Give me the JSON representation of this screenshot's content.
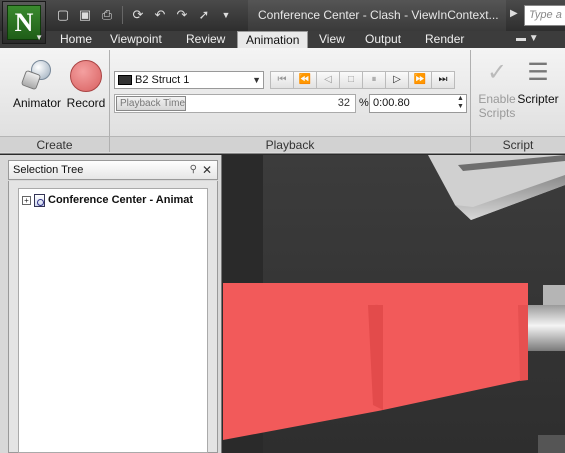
{
  "window": {
    "title": "Conference Center - Clash - ViewInContext...",
    "search_placeholder": "Type a keyword or phrase",
    "app_logo_letter": "N"
  },
  "quick_access": [
    "new-icon",
    "save-icon",
    "print-icon",
    "refresh-icon",
    "undo-icon",
    "redo-icon",
    "select-icon",
    "customize-icon"
  ],
  "tabs": [
    "Home",
    "Viewpoint",
    "Review",
    "Animation",
    "View",
    "Output",
    "Render"
  ],
  "active_tab": "Animation",
  "ribbon": {
    "create": {
      "title": "Create",
      "animator_label": "Animator",
      "record_label": "Record"
    },
    "playback": {
      "title": "Playback",
      "animation_select": "B2 Struct 1",
      "slider_label": "Playback Time",
      "percent_value": "32",
      "percent_symbol": "%",
      "time_value": "0:00.80",
      "progress_percent": 32,
      "transport": {
        "rewind": "⏮",
        "step_back": "⏪",
        "play_reverse": "◁",
        "stop": "□",
        "pause": "⏸",
        "play": "▷",
        "step_forward": "⏩",
        "end": "⏭"
      }
    },
    "script": {
      "title": "Script",
      "enable_scripts_line1": "Enable",
      "enable_scripts_line2": "Scripts",
      "scripter_label": "Scripter"
    }
  },
  "selection_tree": {
    "title": "Selection Tree",
    "root_item": "Conference Center - Animat",
    "expander": "+"
  },
  "colors": {
    "accent_red": "#f25a5a",
    "ribbon_bg": "#e9e9e9",
    "title_bar": "#3a3a3a"
  }
}
